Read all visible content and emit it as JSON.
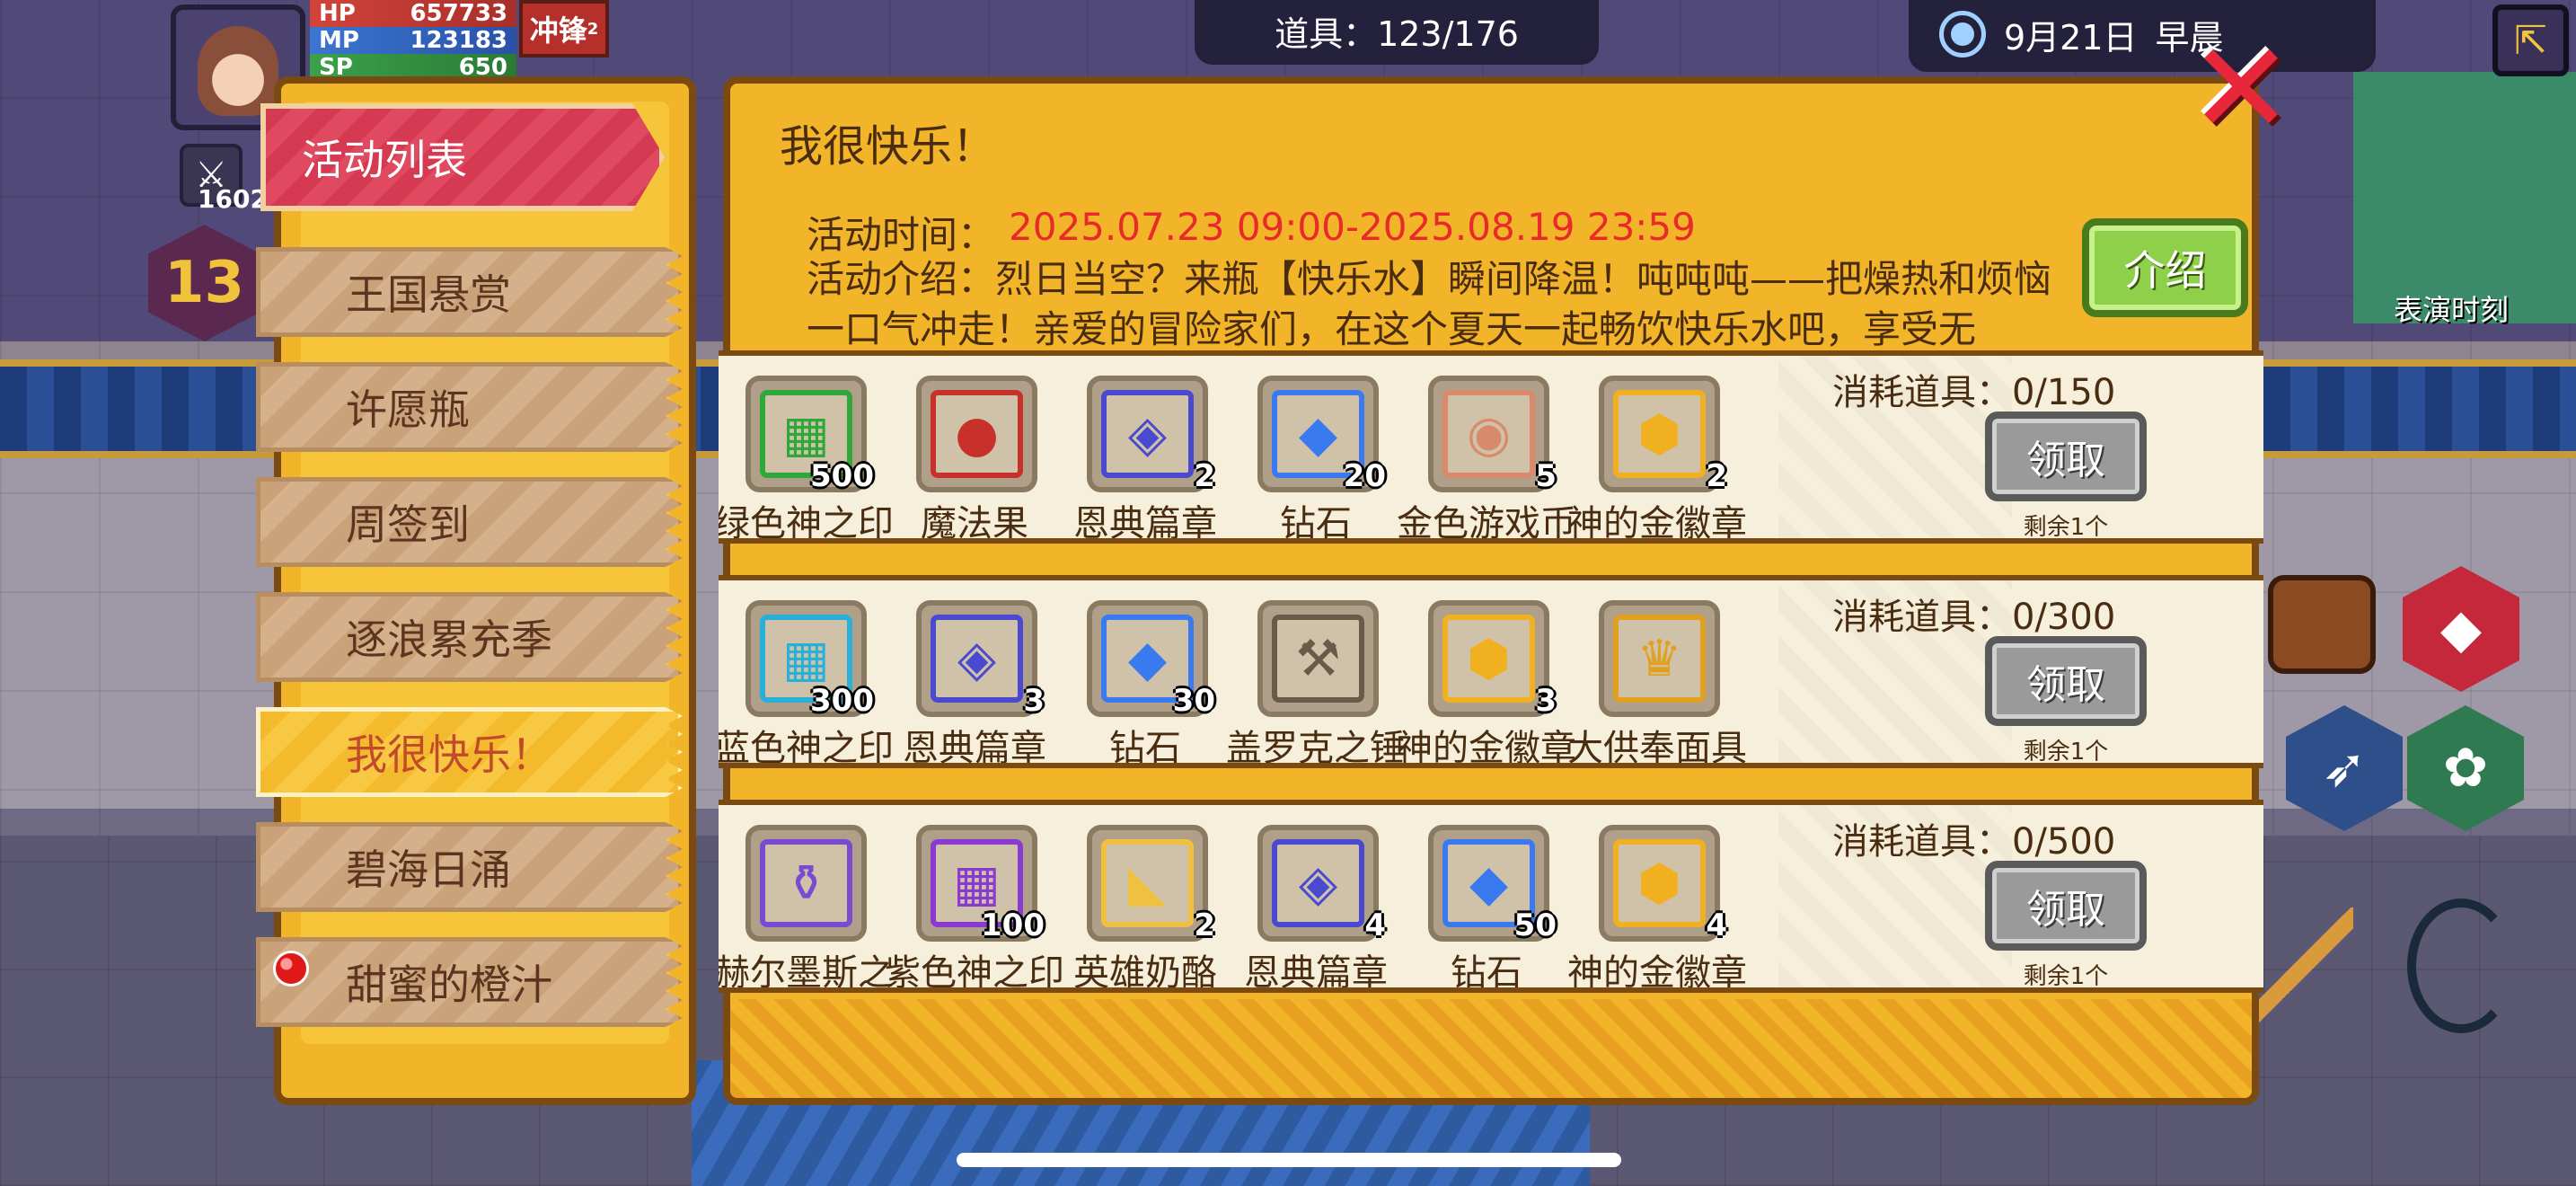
{
  "hud": {
    "hp_label": "HP",
    "hp_value": "657733",
    "mp_label": "MP",
    "mp_value": "123183",
    "sp_label": "SP",
    "sp_value": "650",
    "charge_label": "冲锋",
    "charge_count": "2",
    "level": "13",
    "sword_count": "1602",
    "items_label": "道具：123/176",
    "date": "9月21日",
    "time_of_day": "早晨",
    "side_label": "表演时刻"
  },
  "tabs": {
    "header": "活动列表",
    "items": [
      {
        "label": "王国悬赏"
      },
      {
        "label": "许愿瓶"
      },
      {
        "label": "周签到"
      },
      {
        "label": "逐浪累充季"
      },
      {
        "label": "我很快乐！"
      },
      {
        "label": "碧海日涌"
      },
      {
        "label": "甜蜜的橙汁"
      }
    ]
  },
  "event": {
    "title": "我很快乐！",
    "time_label": "活动时间：",
    "time_value": "2025.07.23 09:00-2025.08.19 23:59",
    "intro": "活动介绍：烈日当空？来瓶【快乐水】瞬间降温！吨吨吨——把燥热和烦恼一口气冲走！亲爱的冒险家们，在这个夏天一起畅饮快乐水吧，享受无",
    "intro_button": "介绍"
  },
  "rewards": [
    {
      "cost": "消耗道具：0/150",
      "claim": "领取",
      "remain": "剩余1个",
      "items": [
        {
          "name": "绿色神之印迹",
          "qty": "500",
          "icon": "green-emblem-icon",
          "frame": "green"
        },
        {
          "name": "魔法果",
          "qty": "",
          "icon": "magic-fruit-icon",
          "frame": "red"
        },
        {
          "name": "恩典篇章",
          "qty": "2",
          "icon": "grace-card-icon",
          "frame": "blue"
        },
        {
          "name": "钻石",
          "qty": "20",
          "icon": "diamond-icon",
          "frame": "purple"
        },
        {
          "name": "金色游戏币",
          "qty": "5",
          "icon": "coin-icon",
          "frame": "orange"
        },
        {
          "name": "神的金徽章",
          "qty": "2",
          "icon": "gold-badge-icon",
          "frame": "orange"
        }
      ]
    },
    {
      "cost": "消耗道具：0/300",
      "claim": "领取",
      "remain": "剩余1个",
      "items": [
        {
          "name": "蓝色神之印迹",
          "qty": "300",
          "icon": "blue-emblem-icon",
          "frame": "blue"
        },
        {
          "name": "恩典篇章",
          "qty": "3",
          "icon": "grace-card-icon",
          "frame": "blue"
        },
        {
          "name": "钻石",
          "qty": "30",
          "icon": "diamond-icon",
          "frame": "purple"
        },
        {
          "name": "盖罗克之锤",
          "qty": "",
          "icon": "hammer-icon",
          "frame": "red"
        },
        {
          "name": "神的金徽章",
          "qty": "3",
          "icon": "gold-badge-icon",
          "frame": "orange"
        },
        {
          "name": "大供奉面具",
          "qty": "",
          "icon": "golden-mask-icon",
          "frame": "orange"
        }
      ]
    },
    {
      "cost": "消耗道具：0/500",
      "claim": "领取",
      "remain": "剩余1个",
      "items": [
        {
          "name": "赫尔墨斯之瓶",
          "qty": "",
          "icon": "potion-icon",
          "frame": "red"
        },
        {
          "name": "紫色神之印迹",
          "qty": "100",
          "icon": "purple-emblem-icon",
          "frame": "purple"
        },
        {
          "name": "英雄奶酪",
          "qty": "2",
          "icon": "cheese-icon",
          "frame": "red"
        },
        {
          "name": "恩典篇章",
          "qty": "4",
          "icon": "grace-card-icon",
          "frame": "blue"
        },
        {
          "name": "钻石",
          "qty": "50",
          "icon": "diamond-icon",
          "frame": "purple"
        },
        {
          "name": "神的金徽章",
          "qty": "4",
          "icon": "gold-badge-icon",
          "frame": "orange"
        }
      ]
    }
  ]
}
